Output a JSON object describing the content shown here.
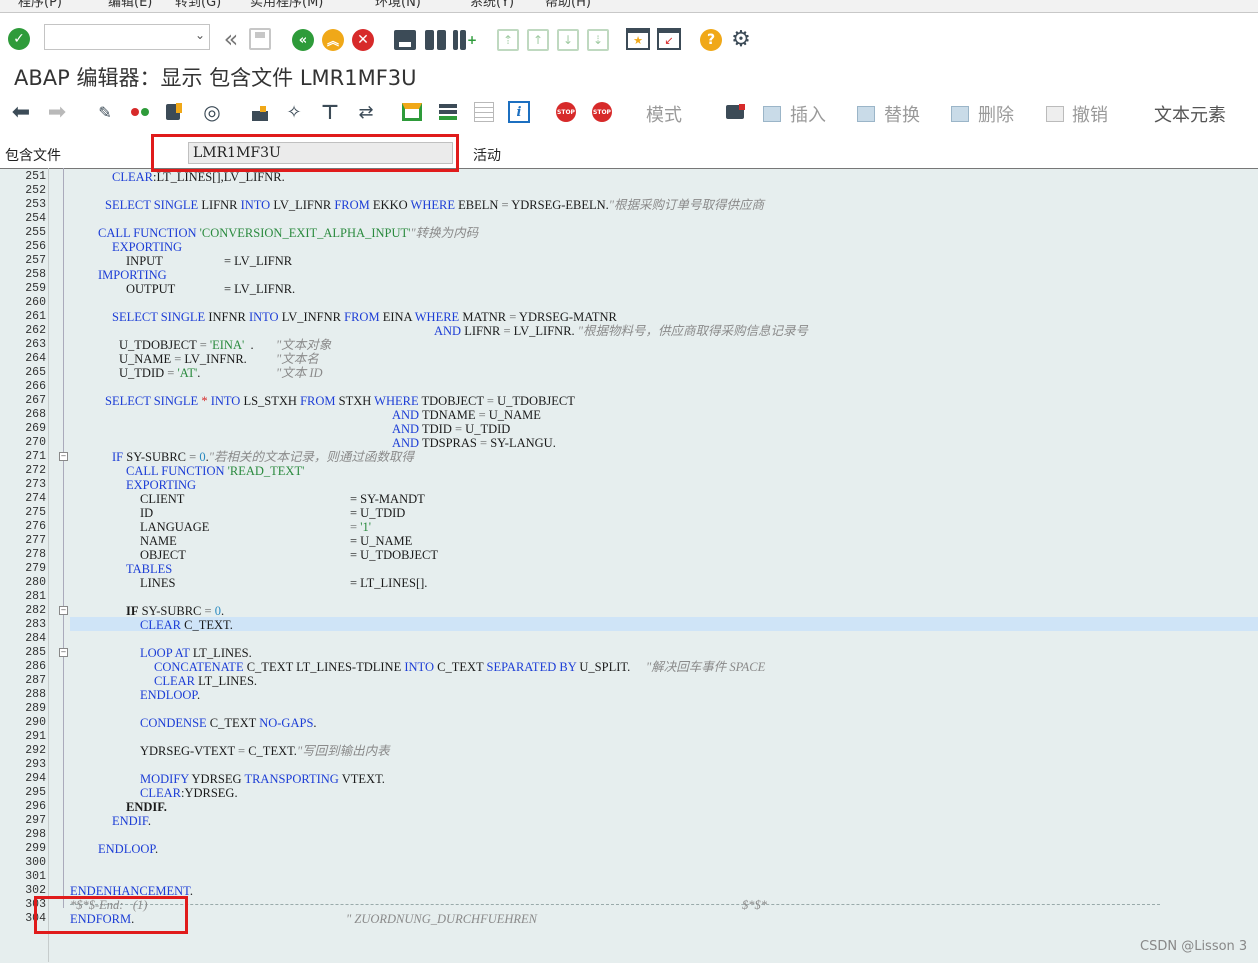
{
  "menubar": {
    "items": [
      "程序(P)",
      "编辑(E)",
      "转到(G)",
      "实用程序(M)",
      "环境(N)",
      "系统(Y)",
      "帮助(H)"
    ]
  },
  "toolbar1": {
    "command_field_value": "",
    "icons": [
      "enter-check-icon",
      "back-double-icon",
      "save-icon",
      "back-icon",
      "exit-icon",
      "cancel-icon",
      "print-icon",
      "find-icon",
      "find-next-icon",
      "first-page-icon",
      "prev-page-icon",
      "next-page-icon",
      "last-page-icon",
      "new-session-icon",
      "shortcut-icon",
      "help-icon",
      "settings-gear-icon"
    ]
  },
  "title": "ABAP 编辑器：显示 包含文件 LMR1MF3U",
  "toolbar2": {
    "pattern": "模式",
    "insert": "插入",
    "replace": "替换",
    "delete": "删除",
    "undo": "撤销",
    "text_elements": "文本元素"
  },
  "include": {
    "label": "包含文件",
    "value": "LMR1MF3U",
    "status": "活动"
  },
  "editor": {
    "line_numbers": [
      "251",
      "252",
      "253",
      "254",
      "255",
      "256",
      "257",
      "258",
      "259",
      "260",
      "261",
      "262",
      "263",
      "264",
      "265",
      "266",
      "267",
      "268",
      "269",
      "270",
      "271",
      "272",
      "273",
      "274",
      "275",
      "276",
      "277",
      "278",
      "279",
      "280",
      "281",
      "282",
      "283",
      "284",
      "285",
      "286",
      "287",
      "288",
      "289",
      "290",
      "291",
      "292",
      "293",
      "294",
      "295",
      "296",
      "297",
      "298",
      "299",
      "300",
      "301",
      "302",
      "303",
      "304"
    ],
    "l251": {
      "kw": "CLEAR",
      "rest": ":LT_LINES[],LV_LIFNR."
    },
    "l253": {
      "k1": "SELECT",
      "k2": "SINGLE",
      "a": " LIFNR ",
      "k3": "INTO",
      "b": " LV_LIFNR ",
      "k4": "FROM",
      "c": " EKKO ",
      "k5": "WHERE",
      "d": " EBELN ",
      "e": "=",
      "f": " YDRSEG-EBELN.",
      "cm": "\"根据采购订单号取得供应商"
    },
    "l255": {
      "k1": "CALL",
      "k2": "FUNCTION",
      "str": "'CONVERSION_EXIT_ALPHA_INPUT'",
      "cm": "\"转换为内码"
    },
    "l256": {
      "kw": "EXPORTING"
    },
    "l257": {
      "a": "INPUT",
      "b": "= LV_LIFNR"
    },
    "l258": {
      "kw": "IMPORTING"
    },
    "l259": {
      "a": "OUTPUT",
      "b": "= LV_LIFNR."
    },
    "l261": {
      "k1": "SELECT",
      "k2": "SINGLE",
      "a": " INFNR ",
      "k3": "INTO",
      "b": " LV_INFNR ",
      "k4": "FROM",
      "c": " EINA ",
      "k5": "WHERE",
      "d": " MATNR ",
      "e": "=",
      "f": " YDRSEG-MATNR"
    },
    "l262": {
      "k1": "AND",
      "a": " LIFNR ",
      "e": "=",
      "b": " LV_LIFNR. ",
      "cm": "\"根据物料号，供应商取得采购信息记录号"
    },
    "l263": {
      "a": "U_TDOBJECT ",
      "e": "=",
      "str": "'EINA'",
      "b": "  .",
      "cm": "\"文本对象"
    },
    "l264": {
      "a": "U_NAME ",
      "e": "=",
      "b": " LV_INFNR.",
      "cm": "\"文本名"
    },
    "l265": {
      "a": "U_TDID ",
      "e": "=",
      "str": "'AT'",
      "b": ".",
      "cm": "\"文本 ID"
    },
    "l267": {
      "k1": "SELECT",
      "k2": "SINGLE",
      "op": "*",
      "k3": "INTO",
      "b": " LS_STXH ",
      "k4": "FROM",
      "c": " STXH ",
      "k5": "WHERE",
      "d": " TDOBJECT ",
      "e": "=",
      "f": " U_TDOBJECT"
    },
    "l268": {
      "k1": "AND",
      "a": " TDNAME ",
      "e": "=",
      "b": " U_NAME"
    },
    "l269": {
      "k1": "AND",
      "a": " TDID ",
      "e": "=",
      "b": " U_TDID"
    },
    "l270": {
      "k1": "AND",
      "a": " TDSPRAS ",
      "e": "=",
      "b": " SY-LANGU."
    },
    "l271": {
      "k1": "IF",
      "a": " SY-SUBRC ",
      "e": "=",
      "num": " 0",
      "b": ".",
      "cm": "\"若相关的文本记录，则通过函数取得"
    },
    "l272": {
      "k1": "CALL",
      "k2": "FUNCTION",
      "str": "'READ_TEXT'"
    },
    "l273": {
      "kw": "EXPORTING"
    },
    "l274": {
      "a": "CLIENT",
      "b": "= SY-MANDT"
    },
    "l275": {
      "a": "ID",
      "b": "= U_TDID"
    },
    "l276": {
      "a": "LANGUAGE",
      "e": "=",
      "str": "'1'"
    },
    "l277": {
      "a": "NAME",
      "b": "= U_NAME"
    },
    "l278": {
      "a": "OBJECT",
      "b": "= U_TDOBJECT"
    },
    "l279": {
      "kw": "TABLES"
    },
    "l280": {
      "a": "LINES",
      "b": "= LT_LINES[]."
    },
    "l282": {
      "k1": "IF",
      "a": " SY-SUBRC ",
      "e": "=",
      "num": " 0",
      "b": "."
    },
    "l283": {
      "kw": "CLEAR",
      "rest": " C_TEXT."
    },
    "l285": {
      "k1": "LOOP",
      "k2": "AT",
      "a": " LT_LINES."
    },
    "l286": {
      "k1": "CONCATENATE",
      "a": " C_TEXT LT_LINES-TDLINE ",
      "k2": "INTO",
      "b": " C_TEXT ",
      "k3": "SEPARATED",
      "k4": "BY",
      "c": " U_SPLIT.",
      "cm": "\"解决回车事件 SPACE"
    },
    "l287": {
      "kw": "CLEAR",
      "rest": " LT_LINES."
    },
    "l288": {
      "kw": "ENDLOOP",
      "rest": "."
    },
    "l290": {
      "kw": "CONDENSE",
      "a": " C_TEXT ",
      "k2": "NO-GAPS",
      "b": "."
    },
    "l292": {
      "a": "YDRSEG-VTEXT ",
      "e": "=",
      "b": " C_TEXT.",
      "cm": "\"写回到输出内表"
    },
    "l294": {
      "k1": "MODIFY",
      "a": " YDRSEG ",
      "k2": "TRANSPORTING",
      "b": " VTEXT."
    },
    "l295": {
      "kw": "CLEAR",
      "rest": ":YDRSEG."
    },
    "l296": {
      "kw": "ENDIF",
      "rest": "."
    },
    "l297": {
      "kw": "ENDIF",
      "rest": "."
    },
    "l299": {
      "kw": "ENDLOOP",
      "rest": "."
    },
    "l302": {
      "kw": "ENDENHANCEMENT",
      "rest": "."
    },
    "l303": {
      "cm": "*$*$-End:   (1)",
      "cm2": "$*$*"
    },
    "l304": {
      "kw": "ENDFORM",
      "rest": ".",
      "cm": "\" ZUORDNUNG_DURCHFUEHREN"
    }
  },
  "watermark": "CSDN @Lisson 3",
  "colors": {
    "keyword": "#1c3dd6",
    "string": "#2a8a3e",
    "comment": "#8a8a8a",
    "highlight_box": "#e01b1b",
    "editor_bg": "#e6eeee"
  }
}
